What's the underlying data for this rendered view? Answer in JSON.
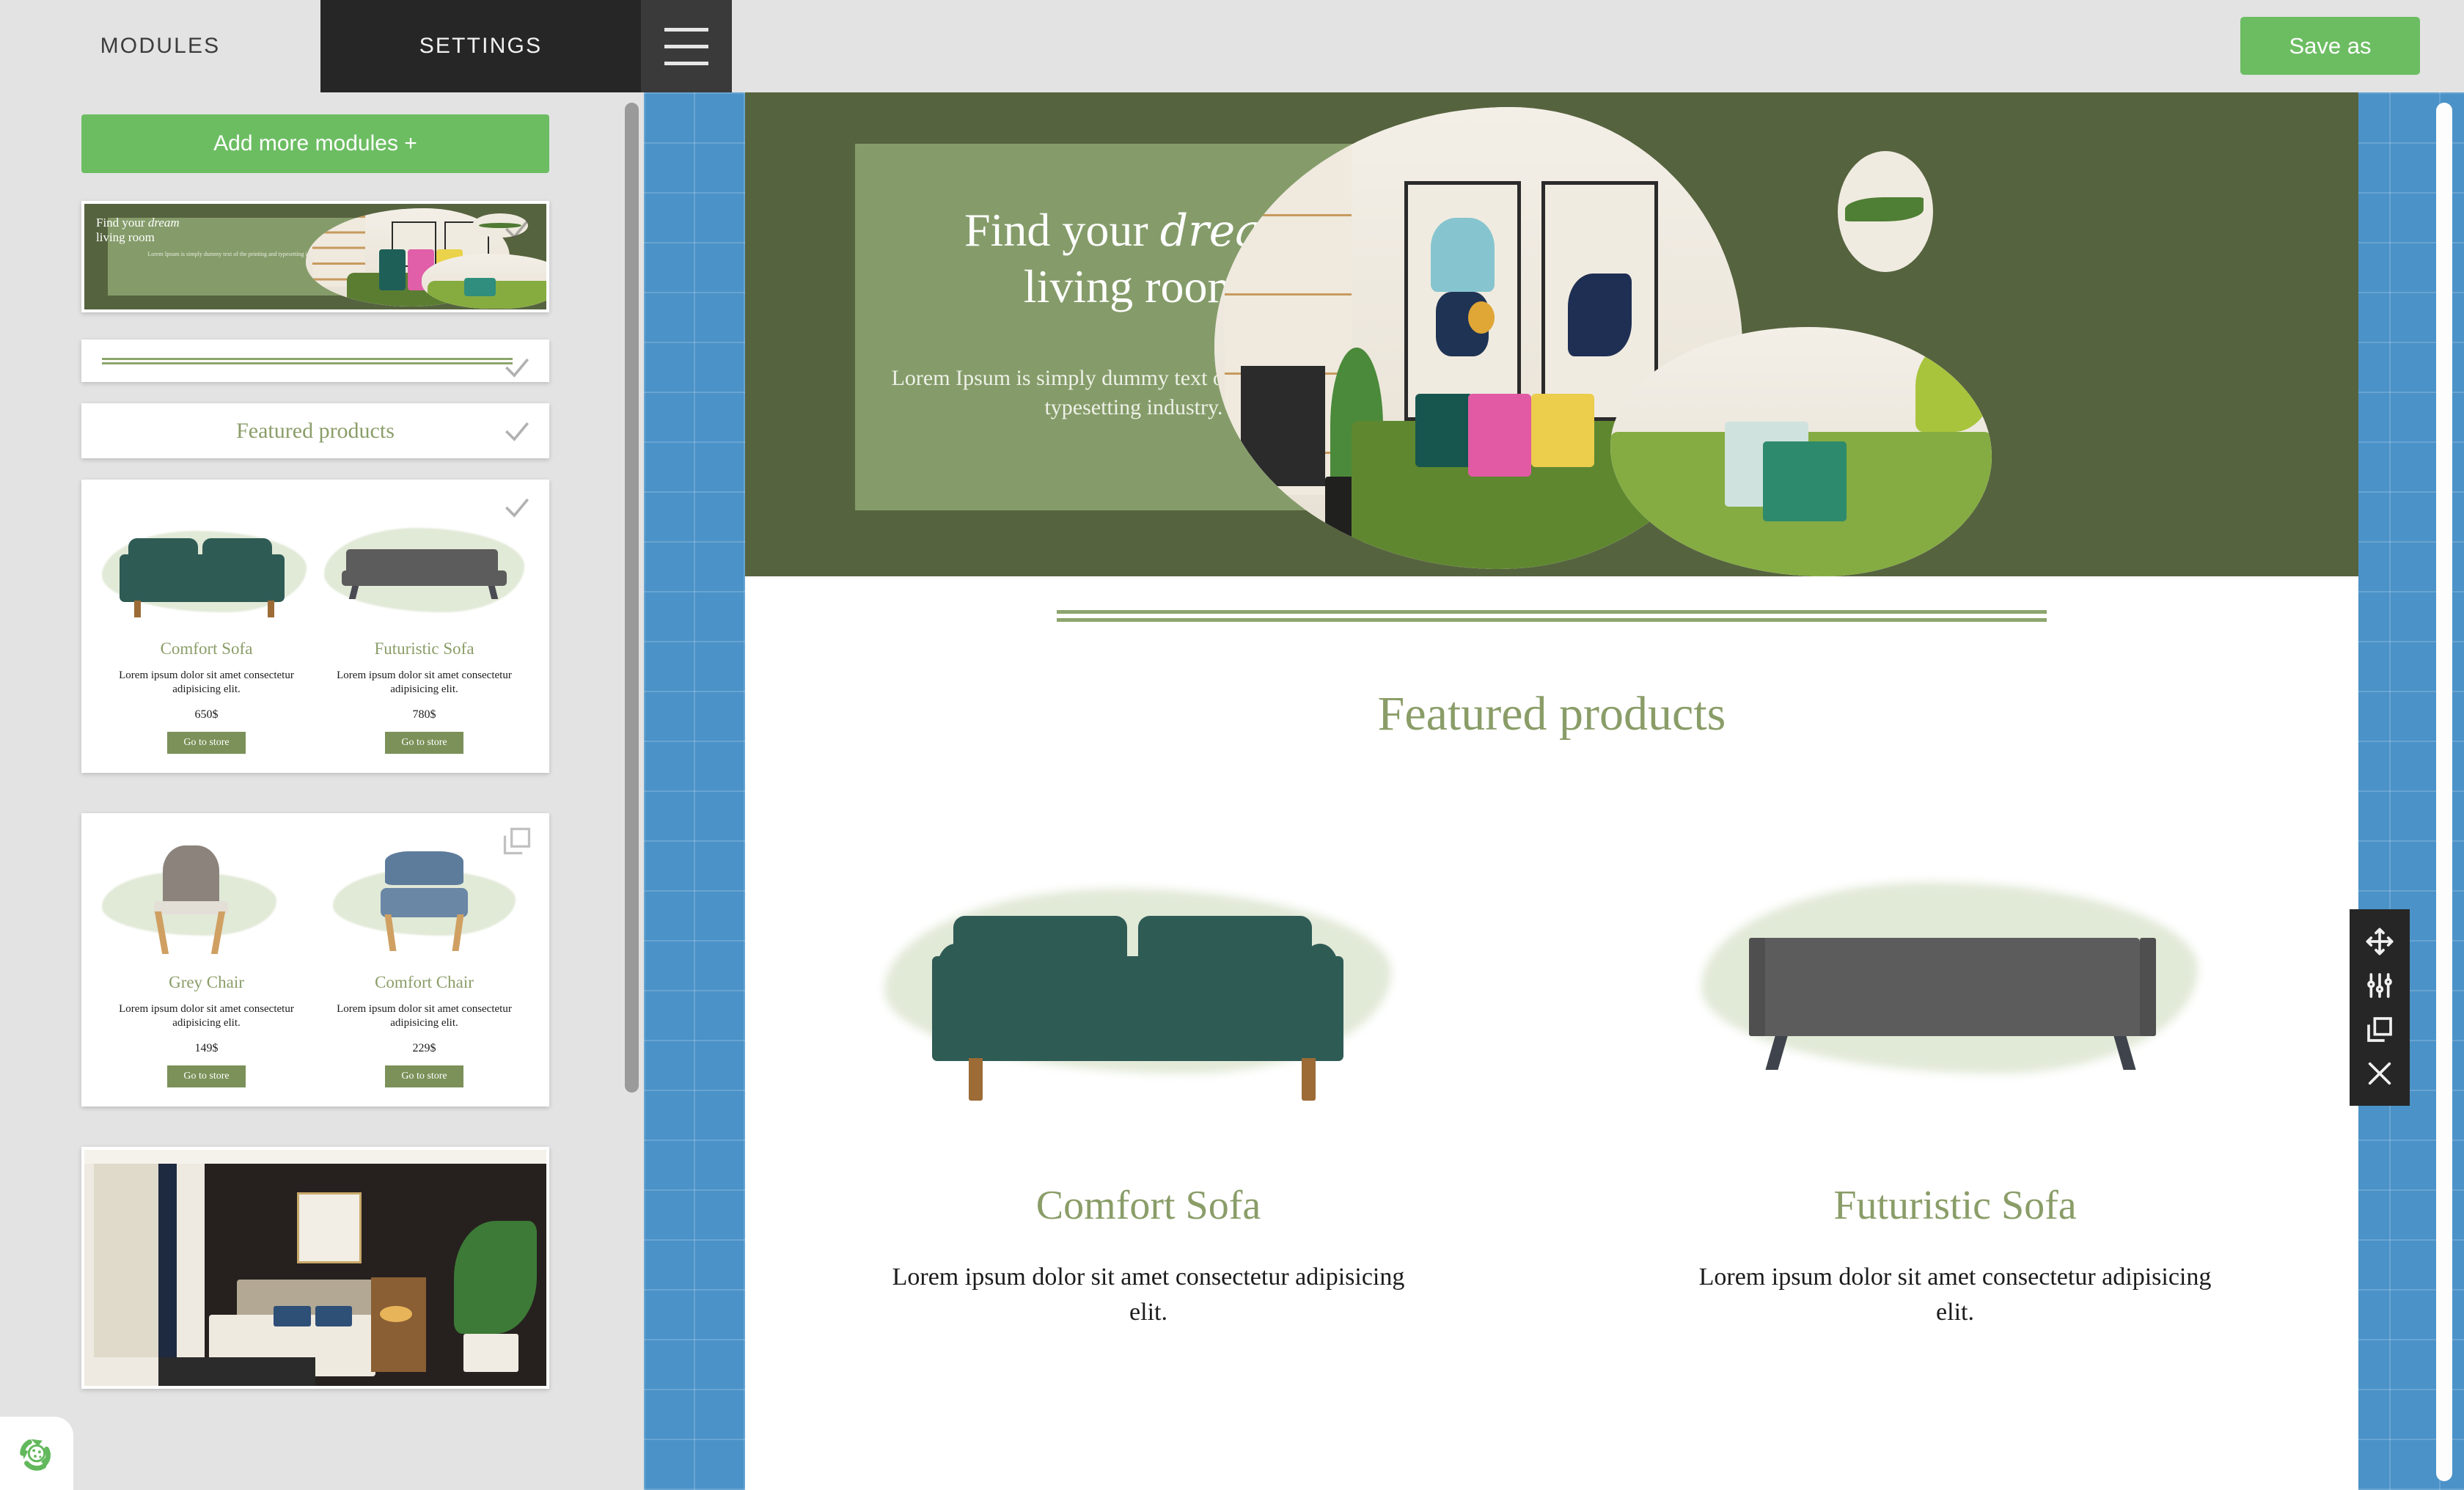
{
  "topbar": {
    "tab_modules": "MODULES",
    "tab_settings": "SETTINGS",
    "menu_icon": "hamburger-menu-icon",
    "save_label": "Save as"
  },
  "sidebar": {
    "add_modules_label": "Add more modules +",
    "modules": [
      {
        "type": "hero",
        "name": "hero-banner-module",
        "icon": "check-icon"
      },
      {
        "type": "divider",
        "name": "divider-module",
        "icon": "check-icon"
      },
      {
        "type": "section-title",
        "name": "featured-title-module",
        "label": "Featured products",
        "icon": "check-icon"
      },
      {
        "type": "products",
        "name": "product-row-module-1",
        "icon": "check-icon"
      },
      {
        "type": "products",
        "name": "product-row-module-2",
        "icon": "duplicate-icon"
      },
      {
        "type": "image",
        "name": "bedroom-image-module"
      }
    ],
    "thumb_hero": {
      "line1": "Find your ",
      "line1_em": "dream",
      "line2": "living room",
      "paragraph": "Lorem Ipsum is simply dummy text of the printing and typesetting industry."
    },
    "thumb_products_1": [
      {
        "name": "Comfort Sofa",
        "desc": "Lorem ipsum dolor sit amet consectetur adipisicing elit.",
        "price": "650$",
        "cta": "Go to store"
      },
      {
        "name": "Futuristic Sofa",
        "desc": "Lorem ipsum dolor sit amet consectetur adipisicing elit.",
        "price": "780$",
        "cta": "Go to store"
      }
    ],
    "thumb_products_2": [
      {
        "name": "Grey Chair",
        "desc": "Lorem ipsum dolor sit amet consectetur adipisicing elit.",
        "price": "149$",
        "cta": "Go to store"
      },
      {
        "name": "Comfort Chair",
        "desc": "Lorem ipsum dolor sit amet consectetur adipisicing elit.",
        "price": "229$",
        "cta": "Go to store"
      }
    ]
  },
  "canvas": {
    "hero": {
      "heading_part1": "Find your ",
      "heading_em": "dream",
      "heading_part2": "living room",
      "paragraph": "Lorem Ipsum is simply dummy text of the printing and typesetting industry."
    },
    "featured_title": "Featured products",
    "products": [
      {
        "name": "Comfort Sofa",
        "desc": "Lorem ipsum dolor sit amet consectetur adipisicing elit."
      },
      {
        "name": "Futuristic Sofa",
        "desc": "Lorem ipsum dolor sit amet consectetur adipisicing elit."
      }
    ]
  },
  "floating_toolbar": {
    "buttons": [
      {
        "name": "move-icon",
        "title": "Move"
      },
      {
        "name": "settings-sliders-icon",
        "title": "Settings"
      },
      {
        "name": "duplicate-icon",
        "title": "Duplicate"
      },
      {
        "name": "close-icon",
        "title": "Delete"
      }
    ]
  },
  "accessibility_badge": {
    "icon": "recycle-accessibility-icon"
  },
  "colors": {
    "accent_green": "#6cbd62",
    "brand_olive": "#8a9d68",
    "hero_dark": "#56633f",
    "hero_light": "#859c6a",
    "canvas_blue": "#4b92c8",
    "settings_dark": "#262626"
  }
}
